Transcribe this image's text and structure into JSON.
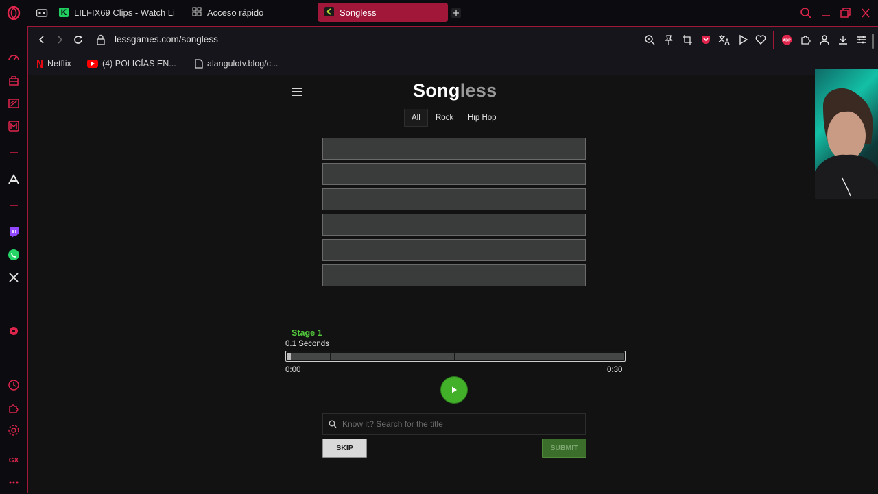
{
  "tabs": [
    {
      "label": "LILFIX69 Clips - Watch Li",
      "icon": "kick-icon"
    },
    {
      "label": "Acceso rápido",
      "icon": "grid-icon"
    },
    {
      "label": "Songless",
      "icon": "songless-icon",
      "active": true
    }
  ],
  "address": {
    "url": "lessgames.com/songless"
  },
  "bookmarks": [
    {
      "label": "Netflix",
      "icon": "netflix-icon"
    },
    {
      "label": "(4) POLICÍAS EN...",
      "icon": "youtube-icon"
    },
    {
      "label": "alangulotv.blog/c...",
      "icon": "page-icon"
    }
  ],
  "sidebar": {
    "bottom_label": "GX"
  },
  "kick_letter": "K",
  "songless": {
    "logo_song": "Song",
    "logo_less": "less",
    "genres": [
      "All",
      "Rock",
      "Hip Hop"
    ],
    "active_genre": "All",
    "guess_slots": 6,
    "stage_label": "Stage 1",
    "seconds_label": "0.1 Seconds",
    "time_start": "0:00",
    "time_end": "0:30",
    "progress_fraction": 0.003,
    "search_placeholder": "Know it? Search for the title",
    "skip_label": "SKIP",
    "submit_label": "SUBMIT"
  },
  "colors": {
    "accent": "#a0173a",
    "play": "#43b02a",
    "stage": "#52c93b"
  }
}
